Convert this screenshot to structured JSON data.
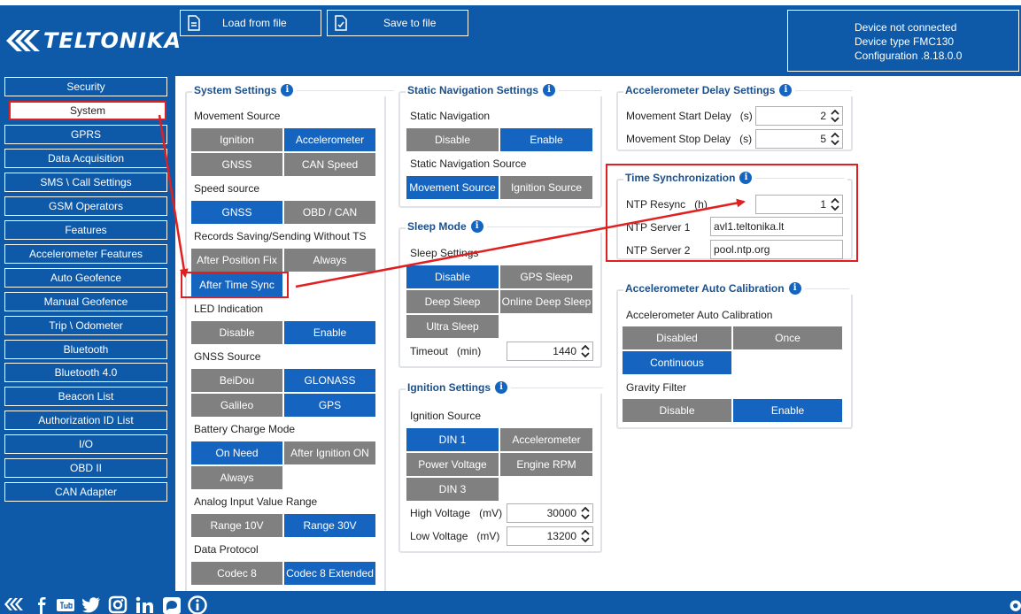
{
  "brand": {
    "name": "TELTONIKA"
  },
  "toolbar": {
    "load_label": "Load from file",
    "save_label": "Save to file"
  },
  "device": {
    "status": "Device not connected",
    "type": "Device type  FMC130",
    "config": "Configuration  .8.18.0.0"
  },
  "sidebar": {
    "items": [
      "Security",
      "System",
      "GPRS",
      "Data Acquisition",
      "SMS \\ Call Settings",
      "GSM Operators",
      "Features",
      "Accelerometer Features",
      "Auto Geofence",
      "Manual Geofence",
      "Trip \\ Odometer",
      "Bluetooth",
      "Bluetooth 4.0",
      "Beacon List",
      "Authorization ID List",
      "I/O",
      "OBD II",
      "CAN Adapter"
    ],
    "active": "System"
  },
  "system": {
    "title": "System Settings",
    "movement_source": {
      "label": "Movement Source",
      "options": [
        "Ignition",
        "Accelerometer",
        "GNSS",
        "CAN Speed"
      ]
    },
    "speed_source": {
      "label": "Speed source",
      "options": [
        "GNSS",
        "OBD / CAN"
      ]
    },
    "records": {
      "label": "Records Saving/Sending Without TS",
      "options": [
        "After Position Fix",
        "Always",
        "After Time Sync"
      ]
    },
    "led": {
      "label": "LED Indication",
      "options": [
        "Disable",
        "Enable"
      ]
    },
    "gnss": {
      "label": "GNSS Source",
      "options": [
        "BeiDou",
        "GLONASS",
        "Galileo",
        "GPS"
      ]
    },
    "battery": {
      "label": "Battery Charge Mode",
      "options": [
        "On Need",
        "After Ignition ON",
        "Always"
      ]
    },
    "analog": {
      "label": "Analog Input Value Range",
      "options": [
        "Range 10V",
        "Range 30V"
      ]
    },
    "protocol": {
      "label": "Data Protocol",
      "options": [
        "Codec 8",
        "Codec 8 Extended"
      ]
    }
  },
  "static_nav": {
    "title": "Static Navigation Settings",
    "nav": {
      "label": "Static Navigation",
      "options": [
        "Disable",
        "Enable"
      ]
    },
    "source": {
      "label": "Static Navigation Source",
      "options": [
        "Movement Source",
        "Ignition Source"
      ]
    }
  },
  "sleep": {
    "title": "Sleep Mode",
    "label": "Sleep Settings",
    "options": [
      "Disable",
      "GPS Sleep",
      "Deep Sleep",
      "Online Deep Sleep",
      "Ultra Sleep"
    ],
    "timeout_label": "Timeout",
    "timeout_unit": "(min)",
    "timeout_value": "1440"
  },
  "ignition": {
    "title": "Ignition Settings",
    "label": "Ignition Source",
    "options": [
      "DIN 1",
      "Accelerometer",
      "Power Voltage",
      "Engine RPM",
      "DIN 3"
    ],
    "high_label": "High Voltage",
    "high_unit": "(mV)",
    "high_value": "30000",
    "low_label": "Low Voltage",
    "low_unit": "(mV)",
    "low_value": "13200"
  },
  "accel_delay": {
    "title": "Accelerometer Delay Settings",
    "start_label": "Movement Start Delay",
    "start_unit": "(s)",
    "start_value": "2",
    "stop_label": "Movement Stop Delay",
    "stop_unit": "(s)",
    "stop_value": "5"
  },
  "time_sync": {
    "title": "Time Synchronization",
    "resync_label": "NTP Resync",
    "resync_unit": "(h)",
    "resync_value": "1",
    "server1_label": "NTP Server 1",
    "server1_value": "avl1.teltonika.lt",
    "server2_label": "NTP Server 2",
    "server2_value": "pool.ntp.org"
  },
  "accel_cal": {
    "title": "Accelerometer Auto Calibration",
    "label": "Accelerometer Auto Calibration",
    "options": [
      "Disabled",
      "Once",
      "Continuous"
    ],
    "gravity_label": "Gravity Filter",
    "gravity_options": [
      "Disable",
      "Enable"
    ]
  },
  "colors": {
    "brand_blue": "#0e5aa8",
    "selected": "#1565c0",
    "unselected": "#808080",
    "highlight": "#e02020"
  },
  "footer_icons": [
    "teltonika-icon",
    "facebook-icon",
    "youtube-icon",
    "twitter-icon",
    "instagram-icon",
    "linkedin-icon",
    "chat-icon",
    "info-icon",
    "gear-icon"
  ]
}
